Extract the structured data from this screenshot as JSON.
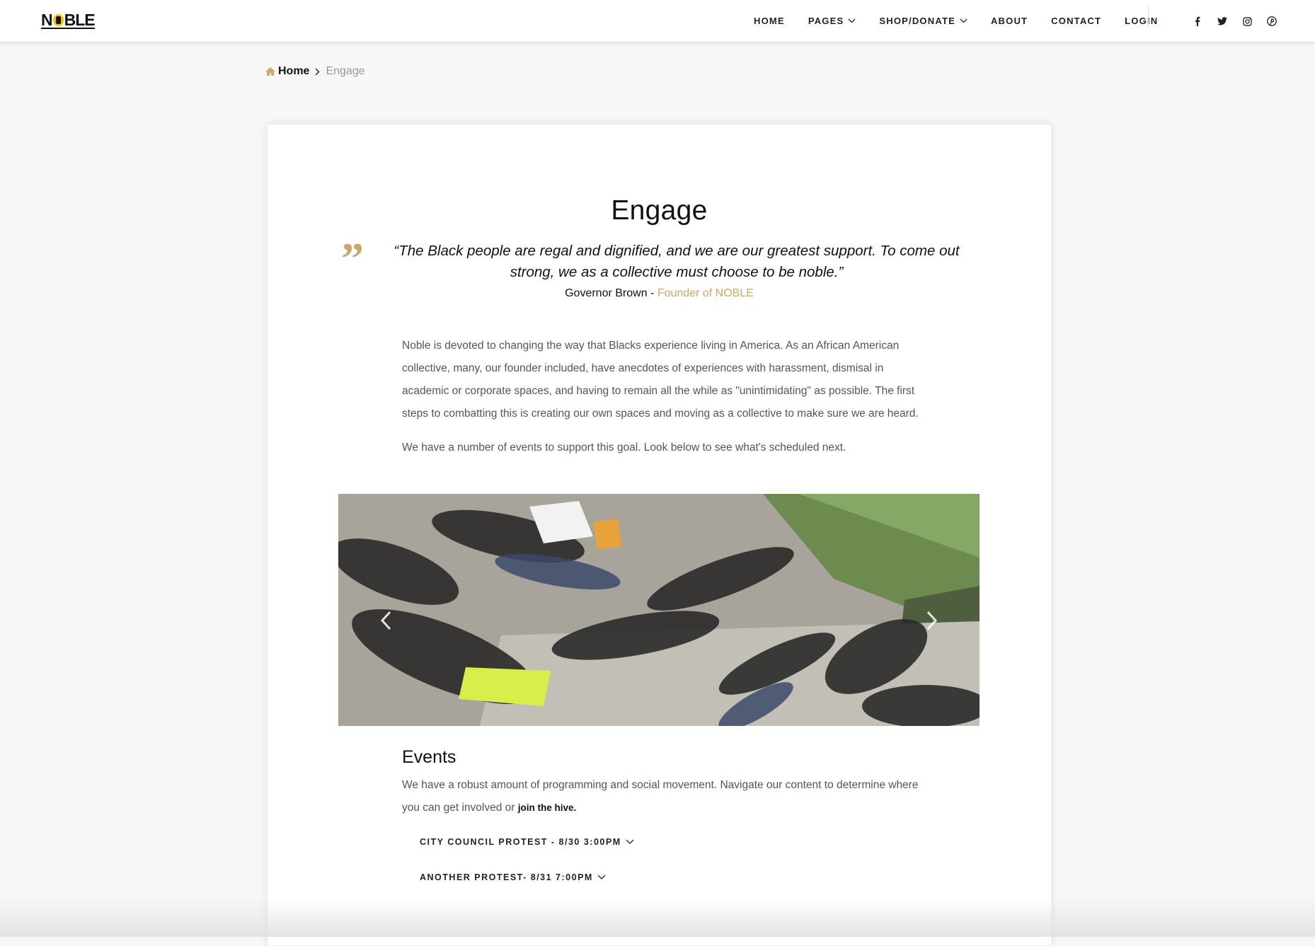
{
  "brand": {
    "logo_text_pre": "N",
    "logo_text_post": "BLE"
  },
  "nav": {
    "items": [
      {
        "label": "HOME",
        "dropdown": false
      },
      {
        "label": "PAGES",
        "dropdown": true
      },
      {
        "label": "SHOP/DONATE",
        "dropdown": true
      },
      {
        "label": "ABOUT",
        "dropdown": false
      },
      {
        "label": "CONTACT",
        "dropdown": false
      },
      {
        "label": "LOGIN",
        "dropdown": false
      }
    ],
    "social_icons": [
      "facebook-icon",
      "twitter-icon",
      "instagram-icon",
      "pinterest-icon"
    ]
  },
  "breadcrumb": {
    "home": "Home",
    "current": "Engage"
  },
  "page": {
    "title": "Engage",
    "quote": "“The Black people are regal and dignified, and we are our greatest support. To come out strong, we as a collective must choose to be noble.”",
    "attribution_name": "Governor Brown - ",
    "attribution_role": "Founder of NOBLE",
    "paragraph1": "Noble is devoted to changing the way that Blacks experience living in America. As an African American collective, many, our founder included, have anecdotes of experiences with harassment, dismisal in academic or corporate spaces, and having to remain all the while as \"unintimidating\" as possible. The first steps to combatting this is creating our own spaces and moving as a collective to make sure we are heard.",
    "paragraph2": "We have a number of events to support this goal. Look below to see what's scheduled next."
  },
  "events": {
    "title": "Events",
    "text": "We have a robust amount of programming and social movement. Navigate our content to determine where you can get involved or ",
    "join_link": "join the hive.",
    "items": [
      "CITY COUNCIL PROTEST - 8/30 3:00PM",
      "ANOTHER PROTEST- 8/31 7:00PM"
    ]
  },
  "colors": {
    "accent": "#c9a96e",
    "logo_yellow": "#f2c200"
  }
}
